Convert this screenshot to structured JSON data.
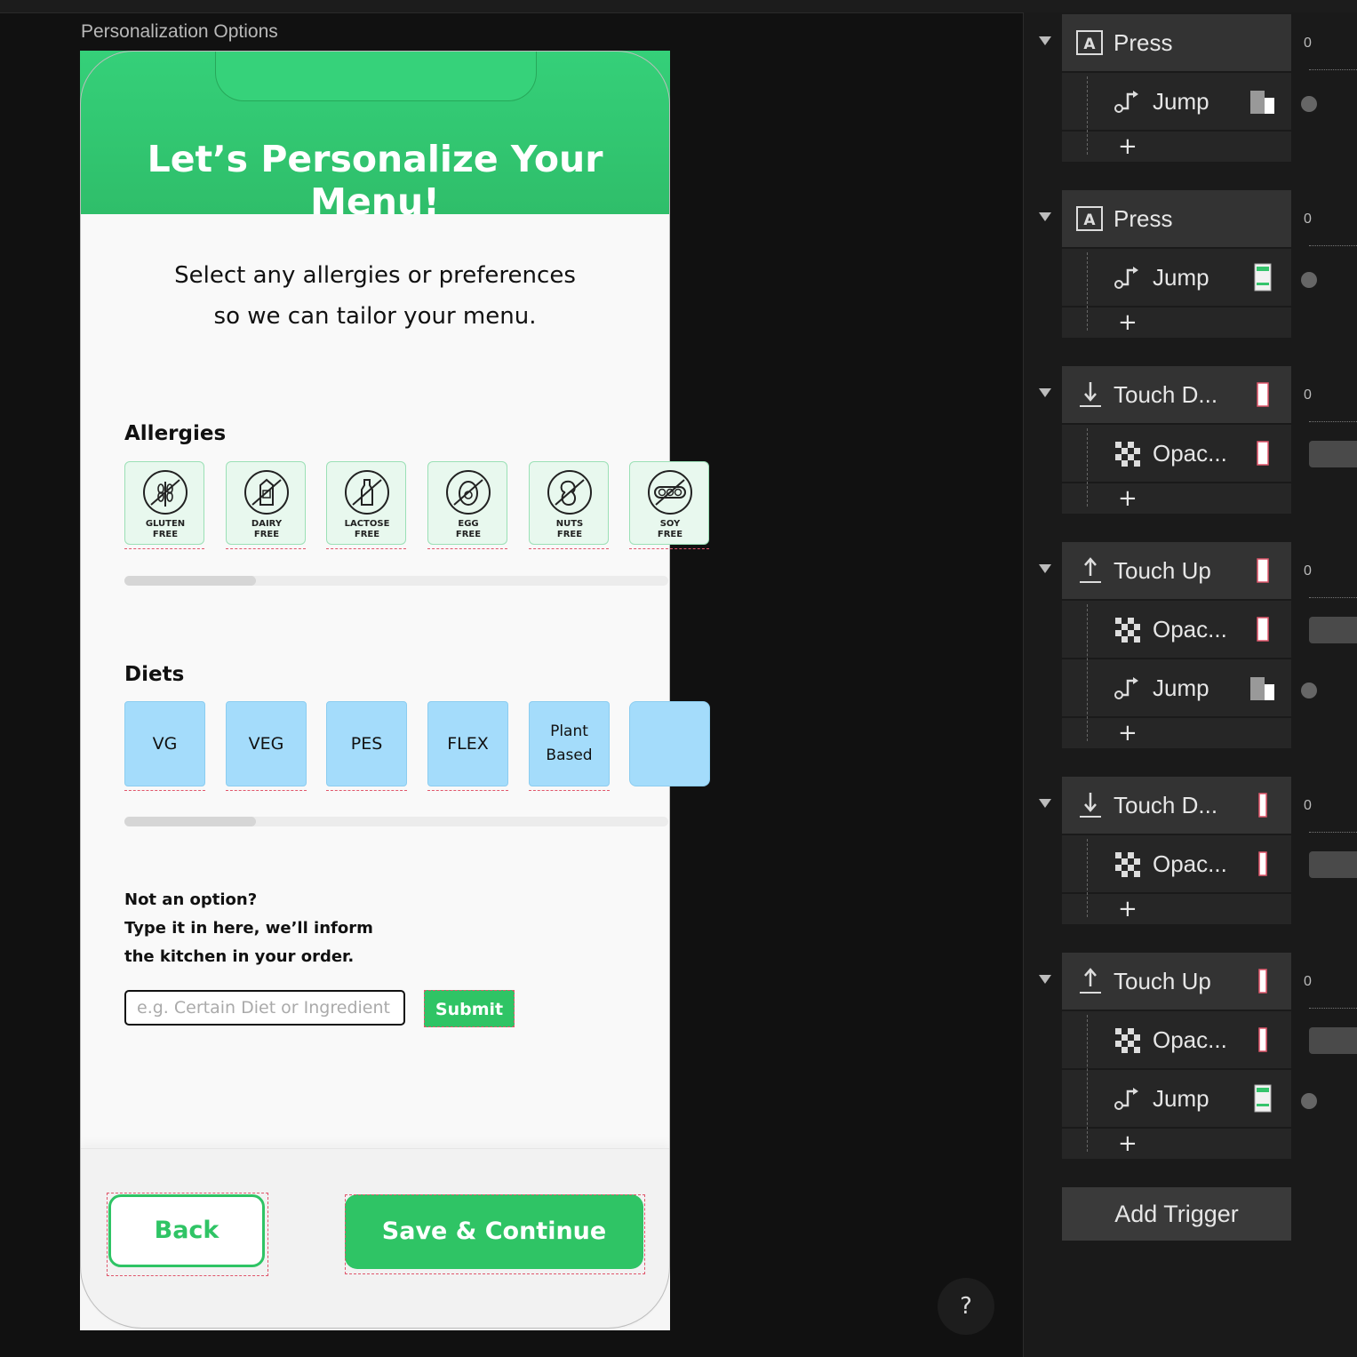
{
  "canvas": {
    "label": "Personalization Options"
  },
  "app": {
    "header_title": "Let’s Personalize Your Menu!",
    "subtitle_line1": "Select any allergies or preferences",
    "subtitle_line2": "so we can tailor your menu.",
    "allergies_title": "Allergies",
    "allergies": [
      {
        "line1": "GLUTEN",
        "line2": "FREE",
        "icon": "wheat-icon"
      },
      {
        "line1": "DAIRY",
        "line2": "FREE",
        "icon": "milk-carton-icon"
      },
      {
        "line1": "LACTOSE",
        "line2": "FREE",
        "icon": "milk-bottle-icon"
      },
      {
        "line1": "EGG",
        "line2": "FREE",
        "icon": "egg-icon"
      },
      {
        "line1": "NUTS",
        "line2": "FREE",
        "icon": "peanut-icon"
      },
      {
        "line1": "SOY",
        "line2": "FREE",
        "icon": "soybean-icon"
      }
    ],
    "diets_title": "Diets",
    "diets": [
      "VG",
      "VEG",
      "PES",
      "FLEX",
      "Plant Based",
      ""
    ],
    "note_line1": "Not an option?",
    "note_line2": "Type it in here, we’ll inform",
    "note_line3": "the kitchen in your order.",
    "input_placeholder": "e.g. Certain Diet or Ingredient",
    "submit_label": "Submit",
    "back_label": "Back",
    "save_label": "Save & Continue"
  },
  "help_label": "?",
  "panel": {
    "zero": "0",
    "press": "Press",
    "jump": "Jump",
    "touch_down": "Touch D...",
    "touch_up": "Touch Up",
    "opacity": "Opac...",
    "plus": "+",
    "add_trigger": "Add Trigger"
  }
}
